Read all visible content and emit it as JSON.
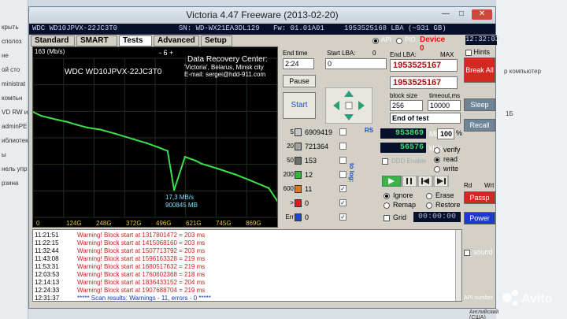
{
  "desktop": {
    "left_lines": [
      "крыть",
      "сполоз",
      "не",
      "ой сто",
      "ministrat",
      "компьн",
      "VD RW и",
      "adminPE",
      "иблиотек",
      "ы",
      "нель упр",
      "рзина"
    ],
    "right_lines": [
      "р компьютер",
      "1Б"
    ],
    "taskbar_text": "Английский (США)"
  },
  "window": {
    "title": "Victoria 4.47  Freeware (2013-02-20)",
    "minimize": "—",
    "maximize": "□",
    "close": "✕"
  },
  "drive": {
    "model": "WDC WD10JPVX-22JC3T0",
    "serial": "SN: WD-WX21EA3DL129",
    "firmware": "Fw: 01.01A01",
    "lba": "1953525168 LBA (~931 GB)",
    "clock": "12:32:03"
  },
  "tabs": [
    "Standard",
    "SMART",
    "Tests",
    "Advanced",
    "Setup"
  ],
  "active_tab": "Tests",
  "mode": {
    "api": "API",
    "pio": "PIO",
    "device": "Device 0"
  },
  "hints": "Hints",
  "graph": {
    "scale": "163 (Mb/s)",
    "nav": "-   6   +",
    "model": "WDC WD10JPVX-22JC3T0",
    "center_title": "Data Recovery Center:",
    "center_city": "'Victoria', Belarus, Minsk city",
    "center_email": "E-mail: sergei@hdd-911.com",
    "speed": "17,3 MB/s",
    "position": "900845 MB",
    "x_labels": [
      "0",
      "124G",
      "248G",
      "372G",
      "496G",
      "621G",
      "745G",
      "869G"
    ]
  },
  "chart_data": {
    "type": "line",
    "title": "",
    "xlabel": "",
    "ylabel": "(Mb/s)",
    "ylim": [
      0,
      163
    ],
    "x_ticks": [
      "0",
      "124G",
      "248G",
      "372G",
      "496G",
      "621G",
      "745G",
      "869G"
    ],
    "series": [
      {
        "x": [
          0,
          30,
          60,
          90,
          124,
          160,
          200,
          248,
          300,
          372,
          420,
          460,
          496,
          520,
          560,
          600,
          621,
          680,
          745,
          800,
          869,
          900
        ],
        "values": [
          108,
          104,
          102,
          100,
          98,
          95,
          92,
          90,
          86,
          80,
          76,
          72,
          68,
          28,
          62,
          58,
          55,
          50,
          44,
          38,
          30,
          17
        ]
      }
    ]
  },
  "controls": {
    "end_time_label": "End time",
    "end_time": "2:24",
    "start_lba_label": "Start LBA:",
    "start_lba": "0",
    "end_lba_label": "End LBA:",
    "max_label": "MAX",
    "end_lba": "1953525167",
    "end_lba2": "1953525167",
    "pause": "Pause",
    "start": "Start",
    "block_size_label": "block size",
    "block_size": "256",
    "timeout_label": "timeout,ms",
    "timeout": "10000",
    "mode_select": "End of test",
    "rs": "RS",
    "to_log": "to log:"
  },
  "blocks": [
    {
      "ms": "5",
      "count": "6909419",
      "color": "#c8c8c8",
      "ck": ""
    },
    {
      "ms": "20",
      "count": "721364",
      "color": "#a0a0a0",
      "ck": ""
    },
    {
      "ms": "50",
      "count": "153",
      "color": "#6c6c6c",
      "ck": ""
    },
    {
      "ms": "200",
      "count": "12",
      "color": "#2fb83a",
      "ck": ""
    },
    {
      "ms": "600",
      "count": "11",
      "color": "#e07a18",
      "ck": "✓"
    },
    {
      "ms": ">",
      "count": "0",
      "color": "#d81f1f",
      "ck": "✓"
    },
    {
      "ms": "Err",
      "count": "0",
      "color": "#1f49c8",
      "ck": "✓"
    }
  ],
  "stats": {
    "mb_done": "953869",
    "mb_unit": "Mb",
    "percent": "100",
    "percent_unit": "%",
    "speed": "56576",
    "speed_unit": "kb/s",
    "ddd_enable": "DDD Enable",
    "verify": "verify",
    "read": "read",
    "write": "write",
    "grid": "Grid",
    "timer": "00:00:00"
  },
  "actions": {
    "ignore": "Ignore",
    "erase": "Erase",
    "remap": "Remap",
    "restore": "Restore"
  },
  "side": {
    "break_all": "Break All",
    "sleep": "Sleep",
    "recall": "Recall",
    "rd": "Rd",
    "wrt": "Wrt",
    "passp": "Passp",
    "power": "Power",
    "sound": "sound",
    "api_number": "API number"
  },
  "log": [
    {
      "time": "11:21:51",
      "msg": "Warning! Block start at 1317801472 = 203 ms"
    },
    {
      "time": "11:22:15",
      "msg": "Warning! Block start at 1415068160 = 203 ms"
    },
    {
      "time": "11:32:44",
      "msg": "Warning! Block start at 1507713792 = 203 ms"
    },
    {
      "time": "11:43:08",
      "msg": "Warning! Block start at 1596163328 = 219 ms"
    },
    {
      "time": "11:53:31",
      "msg": "Warning! Block start at 1680517632 = 219 ms"
    },
    {
      "time": "12:03:53",
      "msg": "Warning! Block start at 1760602368 = 218 ms"
    },
    {
      "time": "12:14:13",
      "msg": "Warning! Block start at 1836433152 = 204 ms"
    },
    {
      "time": "12:24:33",
      "msg": "Warning! Block start at 1907688704 = 219 ms"
    },
    {
      "time": "12:31:37",
      "msg": "***** Scan results: Warnings - 11, errors - 0 *****"
    }
  ],
  "watermark": "Avito"
}
